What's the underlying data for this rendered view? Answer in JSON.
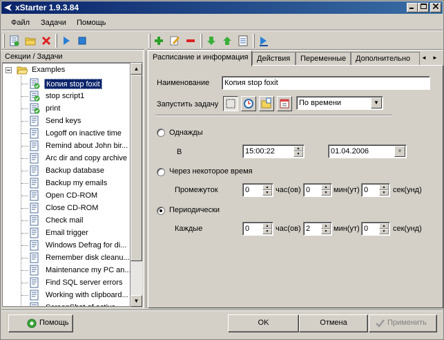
{
  "window": {
    "title": "xStarter 1.9.3.84"
  },
  "menu": [
    "Файл",
    "Задачи",
    "Помощь"
  ],
  "left_panel": {
    "header": "Секции / Задачи",
    "root": "Examples",
    "items": [
      {
        "label": "Копия stop foxit",
        "icon": "task-check-icon",
        "selected": true
      },
      {
        "label": "stop script1",
        "icon": "task-check-icon"
      },
      {
        "label": "print",
        "icon": "task-check-icon"
      },
      {
        "label": "Send keys",
        "icon": "task-icon"
      },
      {
        "label": "Logoff on inactive time",
        "icon": "task-icon"
      },
      {
        "label": "Remind about John bir...",
        "icon": "task-icon"
      },
      {
        "label": "Arc dir and copy archive",
        "icon": "task-icon"
      },
      {
        "label": "Backup database",
        "icon": "task-icon"
      },
      {
        "label": "Backup my emails",
        "icon": "task-icon"
      },
      {
        "label": "Open CD-ROM",
        "icon": "task-icon"
      },
      {
        "label": "Close CD-ROM",
        "icon": "task-icon"
      },
      {
        "label": "Check mail",
        "icon": "task-icon"
      },
      {
        "label": "Email trigger",
        "icon": "task-icon"
      },
      {
        "label": "Windows Defrag for di...",
        "icon": "task-icon"
      },
      {
        "label": "Remember disk cleanu...",
        "icon": "task-icon"
      },
      {
        "label": "Maintenance my PC an...",
        "icon": "task-icon"
      },
      {
        "label": "Find SQL server errors",
        "icon": "task-icon"
      },
      {
        "label": "Working with clipboard...",
        "icon": "task-icon"
      },
      {
        "label": "ScreenShot of active ...",
        "icon": "task-icon"
      }
    ]
  },
  "tabs": [
    "Расписание и информация",
    "Действия",
    "Переменные",
    "Дополнительно"
  ],
  "form": {
    "name_label": "Наименование",
    "name_value": "Копия stop foxit",
    "run_label": "Запустить задачу",
    "run_mode": "По времени",
    "once": {
      "label": "Однажды",
      "at_label": "В",
      "time": "15:00:22",
      "date": "01.04.2006"
    },
    "after": {
      "label": "Через некоторое время",
      "interval_label": "Промежуток",
      "hours": "0",
      "hours_unit": "час(ов)",
      "minutes": "0",
      "minutes_unit": "мин(ут)",
      "seconds": "0",
      "seconds_unit": "сек(унд)"
    },
    "periodic": {
      "label": "Периодически",
      "every_label": "Каждые",
      "hours": "0",
      "hours_unit": "час(ов)",
      "minutes": "2",
      "minutes_unit": "мин(ут)",
      "seconds": "0",
      "seconds_unit": "сек(унд)"
    },
    "selected_mode": "periodic"
  },
  "buttons": {
    "help": "Помощь",
    "ok": "OK",
    "cancel": "Отмена",
    "apply": "Применить"
  }
}
